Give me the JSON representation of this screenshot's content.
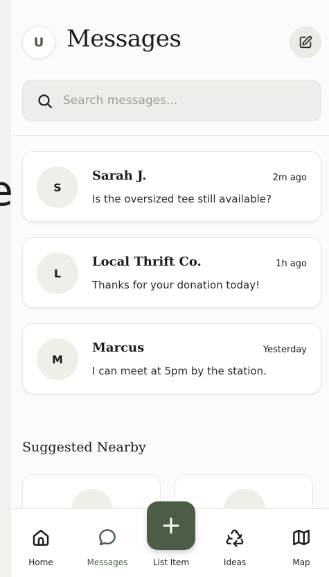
{
  "header": {
    "avatar_initial": "U",
    "title": "Messages",
    "compose_icon": "pencil-square-icon"
  },
  "search": {
    "placeholder": "Search messages...",
    "icon": "search-icon"
  },
  "conversations": [
    {
      "initial": "S",
      "name": "Sarah J.",
      "time": "2m ago",
      "preview": "Is the oversized tee still available?"
    },
    {
      "initial": "L",
      "name": "Local Thrift Co.",
      "time": "1h ago",
      "preview": "Thanks for your donation today!"
    },
    {
      "initial": "M",
      "name": "Marcus",
      "time": "Yesterday",
      "preview": "I can meet at 5pm by the station."
    }
  ],
  "suggested": {
    "title": "Suggested Nearby"
  },
  "nav": {
    "items": [
      {
        "label": "Home",
        "icon": "home-icon"
      },
      {
        "label": "Messages",
        "icon": "chat-bubble-icon",
        "active": true
      },
      {
        "label": "List Item",
        "icon": "plus-icon"
      },
      {
        "label": "Ideas",
        "icon": "recycle-icon"
      },
      {
        "label": "Map",
        "icon": "map-icon"
      }
    ]
  },
  "colors": {
    "accent": "#4b5d46",
    "background": "#fbfbf9",
    "card": "#ffffff",
    "search_bg": "#eceee9"
  }
}
